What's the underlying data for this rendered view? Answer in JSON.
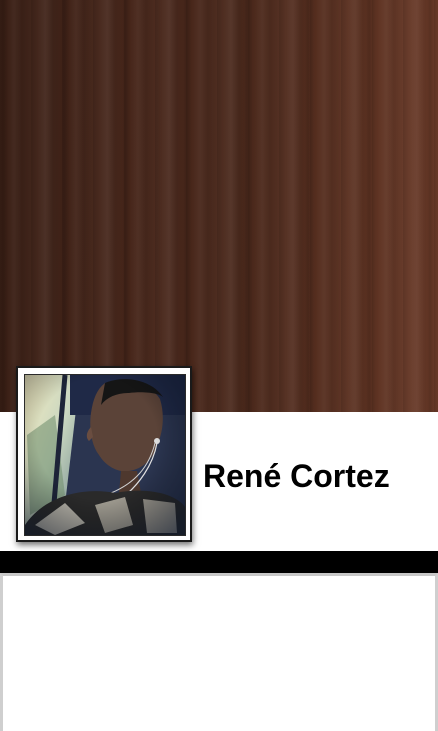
{
  "profile": {
    "name": "René Cortez",
    "avatar_icon": "profile-photo",
    "cover_style": "wood-texture"
  },
  "colors": {
    "cover_wood": "#4a281b",
    "header_bg": "#ffffff",
    "divider": "#000000",
    "name_text": "#000000"
  }
}
